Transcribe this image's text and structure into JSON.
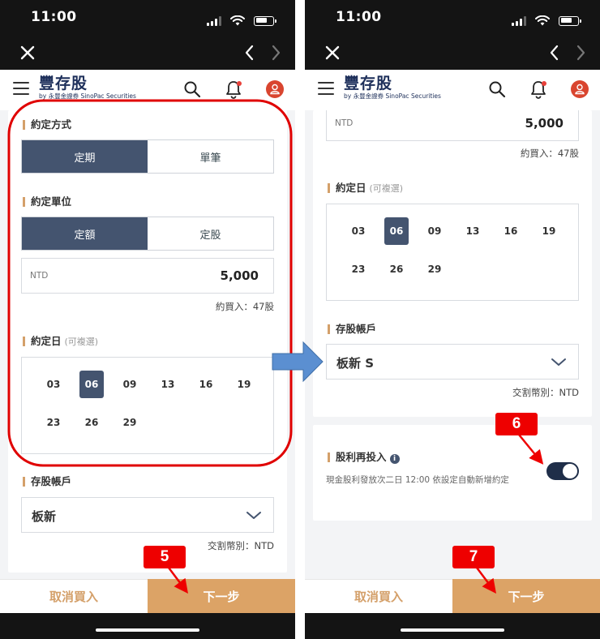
{
  "status_bar": {
    "time": "11:00"
  },
  "app": {
    "logo_main": "豐存股",
    "logo_sub": "by 永豐金證券 SinoPac Securities"
  },
  "left": {
    "agreement_method": {
      "title": "約定方式",
      "options": [
        "定期",
        "單筆"
      ],
      "selected": "定期"
    },
    "agreement_unit": {
      "title": "約定單位",
      "options": [
        "定額",
        "定股"
      ],
      "selected": "定額"
    },
    "amount": {
      "currency": "NTD",
      "value": "5,000",
      "note": "約買入：47股"
    },
    "agreement_day": {
      "title": "約定日",
      "hint": "(可複選)",
      "days": [
        "03",
        "06",
        "09",
        "13",
        "16",
        "19",
        "23",
        "26",
        "29"
      ],
      "selected": "06"
    },
    "account": {
      "title": "存股帳戶",
      "value": "板新",
      "settlement": "交割幣別：NTD"
    },
    "buttons": {
      "cancel": "取消買入",
      "next": "下一步"
    }
  },
  "right": {
    "amount": {
      "currency": "NTD",
      "value": "5,000",
      "note": "約買入：47股"
    },
    "agreement_day": {
      "title": "約定日",
      "hint": "(可複選)",
      "days": [
        "03",
        "06",
        "09",
        "13",
        "16",
        "19",
        "23",
        "26",
        "29"
      ],
      "selected": "06"
    },
    "account": {
      "title": "存股帳戶",
      "value": "板新 S",
      "settlement": "交割幣別：NTD"
    },
    "dividend_reinvest": {
      "title": "股利再投入",
      "description": "現金股利發放次二日 12:00 依設定自動新增約定",
      "enabled": true
    },
    "buttons": {
      "cancel": "取消買入",
      "next": "下一步"
    }
  },
  "annotations": {
    "step5": "5",
    "step6": "6",
    "step7": "7"
  },
  "colors": {
    "accent_gold": "#dca366",
    "selected_navy": "#44546f",
    "annotation_red": "#ee0000",
    "arrow_blue": "#5b8fd1"
  }
}
